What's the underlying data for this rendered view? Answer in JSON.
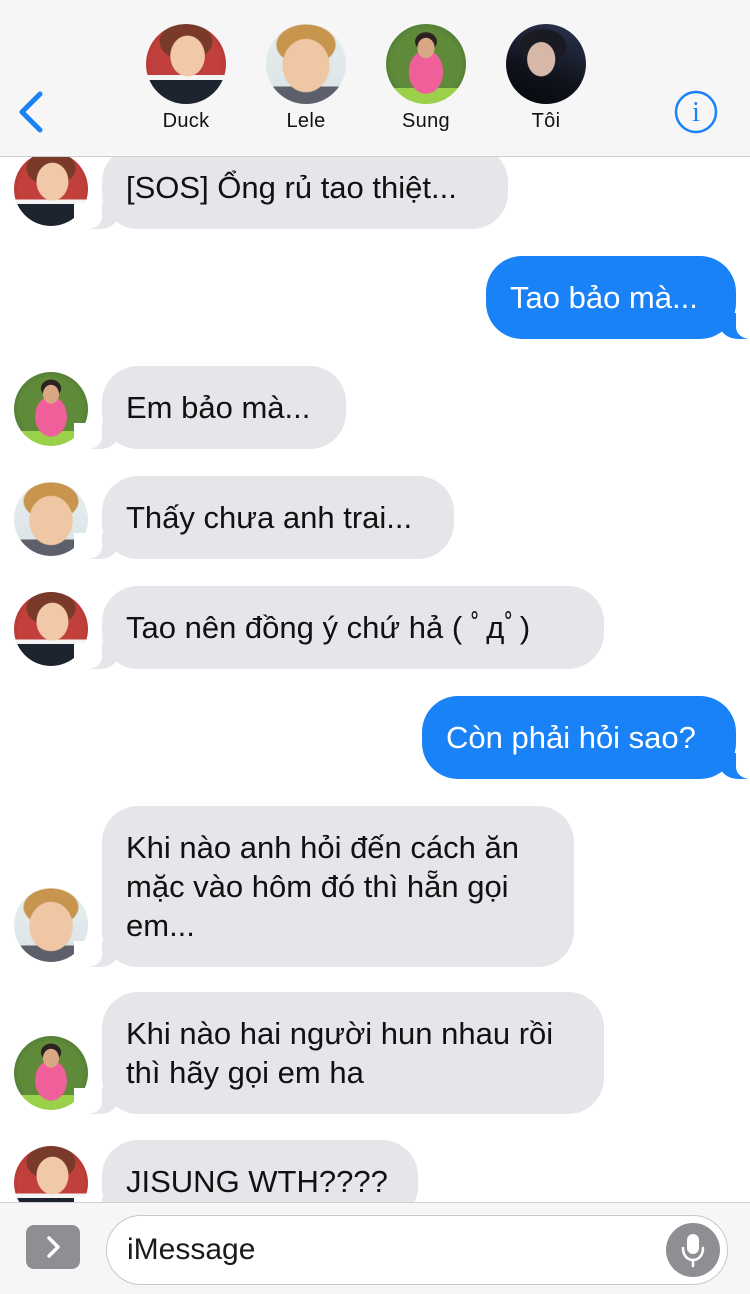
{
  "header": {
    "back_icon": "chevron-left-icon",
    "info_icon": "info-circle-icon",
    "accent_color": "#1a82f7",
    "participants": [
      {
        "name": "Duck"
      },
      {
        "name": "Lele"
      },
      {
        "name": "Sung"
      },
      {
        "name": "Tôi"
      }
    ]
  },
  "messages": [
    {
      "sender": "Duck",
      "direction": "incoming",
      "text": "[SOS] Ổng rủ tao thiệt..."
    },
    {
      "sender": "Tôi",
      "direction": "outgoing",
      "text": "Tao bảo mà..."
    },
    {
      "sender": "Sung",
      "direction": "incoming",
      "text": "Em bảo mà..."
    },
    {
      "sender": "Lele",
      "direction": "incoming",
      "text": "Thấy chưa anh trai..."
    },
    {
      "sender": "Duck",
      "direction": "incoming",
      "text": "Tao nên đồng ý chứ hả ( ﾟдﾟ)"
    },
    {
      "sender": "Tôi",
      "direction": "outgoing",
      "text": "Còn phải hỏi sao?"
    },
    {
      "sender": "Lele",
      "direction": "incoming",
      "text": "Khi nào anh hỏi đến cách ăn mặc vào hôm đó thì hẵn gọi em..."
    },
    {
      "sender": "Sung",
      "direction": "incoming",
      "text": "Khi nào hai người hun nhau rồi thì hãy gọi em ha"
    },
    {
      "sender": "Duck",
      "direction": "incoming",
      "text": "JISUNG WTH????"
    }
  ],
  "composer": {
    "placeholder": "iMessage",
    "apps_icon": "chevron-right-icon",
    "mic_icon": "microphone-icon"
  },
  "colors": {
    "incoming_bubble": "#e5e5ea",
    "outgoing_bubble": "#1a82f7",
    "header_bg": "#f6f6f7"
  }
}
